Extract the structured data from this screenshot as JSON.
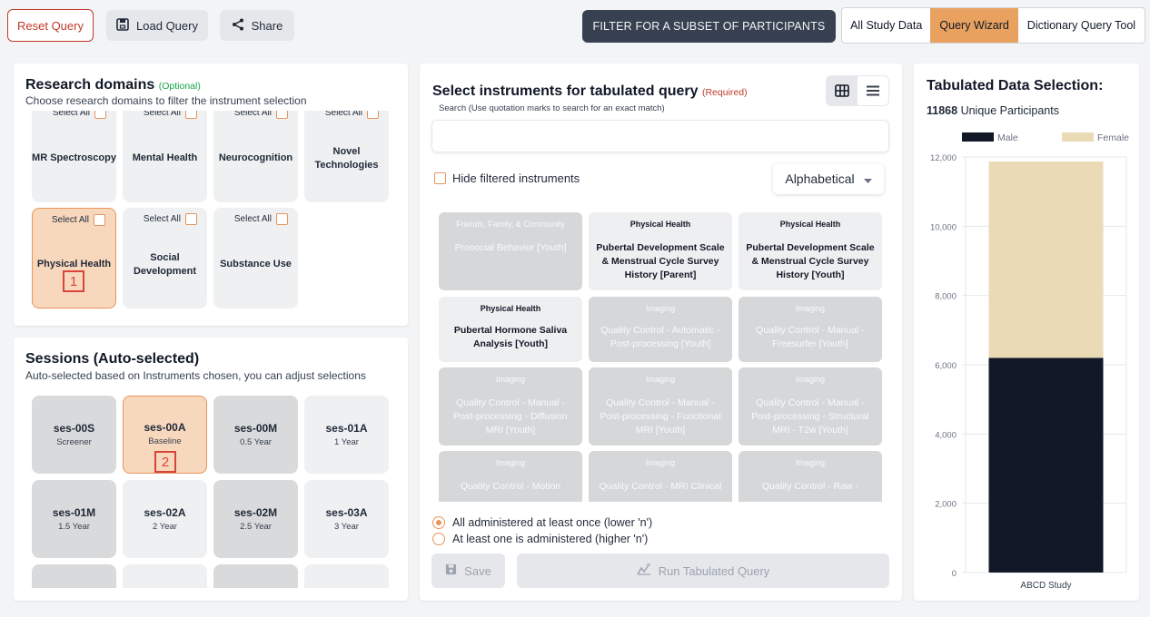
{
  "toolbar": {
    "reset_label": "Reset Query",
    "load_label": "Load Query",
    "share_label": "Share",
    "filter_label": "FILTER FOR A SUBSET OF PARTICIPANTS",
    "tabs": [
      "All Study Data",
      "Query Wizard",
      "Dictionary Query Tool"
    ],
    "active_tab": "Query Wizard"
  },
  "domains": {
    "title": "Research domains",
    "optional": "(Optional)",
    "subtitle": "Choose research domains to filter the instrument selection",
    "select_all_label": "Select All",
    "cards": [
      {
        "label": "MR Spectroscopy",
        "state": "default"
      },
      {
        "label": "Mental Health",
        "state": "default"
      },
      {
        "label": "Neurocognition",
        "state": "default"
      },
      {
        "label": "Novel Technologies",
        "state": "default"
      },
      {
        "label": "Physical Health",
        "state": "selected",
        "marker": "1"
      },
      {
        "label": "Social Development",
        "state": "default"
      },
      {
        "label": "Substance Use",
        "state": "default"
      }
    ]
  },
  "sessions": {
    "title": "Sessions (Auto-selected)",
    "subtitle": "Auto-selected based on Instruments chosen, you can adjust selections",
    "cards": [
      {
        "name": "ses-00S",
        "sub": "Screener",
        "state": "grey"
      },
      {
        "name": "ses-00A",
        "sub": "Baseline",
        "state": "selected",
        "marker": "2"
      },
      {
        "name": "ses-00M",
        "sub": "0.5 Year",
        "state": "grey"
      },
      {
        "name": "ses-01A",
        "sub": "1 Year",
        "state": "light"
      },
      {
        "name": "ses-01M",
        "sub": "1.5 Year",
        "state": "grey"
      },
      {
        "name": "ses-02A",
        "sub": "2 Year",
        "state": "light"
      },
      {
        "name": "ses-02M",
        "sub": "2.5 Year",
        "state": "grey"
      },
      {
        "name": "ses-03A",
        "sub": "3 Year",
        "state": "light"
      }
    ]
  },
  "instruments": {
    "title": "Select instruments for tabulated query",
    "required": "(Required)",
    "search_hint": "Search (Use quotation marks to search for an exact match)",
    "search_value": "",
    "hide_filtered_label": "Hide filtered instruments",
    "sort_value": "Alphabetical",
    "cards": [
      {
        "category": "Friends, Family, & Community",
        "name": "Prosocial Behavior [Youth]",
        "state": "grey"
      },
      {
        "category": "Physical Health",
        "name": "Pubertal Development Scale & Menstrual Cycle Survey History [Parent]",
        "state": "white"
      },
      {
        "category": "Physical Health",
        "name": "Pubertal Development Scale & Menstrual Cycle Survey History [Youth]",
        "state": "white"
      },
      {
        "category": "Physical Health",
        "name": "Pubertal Hormone Saliva Analysis [Youth]",
        "state": "white"
      },
      {
        "category": "Imaging",
        "name": "Quality Control - Automatic - Post-processing [Youth]",
        "state": "grey"
      },
      {
        "category": "Imaging",
        "name": "Quality Control - Manual - Freesurfer [Youth]",
        "state": "grey"
      },
      {
        "category": "Imaging",
        "name": "Quality Control - Manual - Post-processing - Diffusion MRI [Youth]",
        "state": "grey"
      },
      {
        "category": "Imaging",
        "name": "Quality Control - Manual - Post-processing - Functional MRI [Youth]",
        "state": "grey"
      },
      {
        "category": "Imaging",
        "name": "Quality Control - Manual - Post-processing - Structural MRI - T2w [Youth]",
        "state": "grey"
      },
      {
        "category": "Imaging",
        "name": "Quality Control - Motion",
        "state": "grey"
      },
      {
        "category": "Imaging",
        "name": "Quality Control - MRI Clinical",
        "state": "grey"
      },
      {
        "category": "Imaging",
        "name": "Quality Control - Raw -",
        "state": "grey"
      }
    ],
    "radio_options": [
      {
        "label": "All administered at least once (lower 'n')",
        "checked": true
      },
      {
        "label": "At least one is administered (higher 'n')",
        "checked": false
      }
    ],
    "save_label": "Save",
    "run_label": "Run Tabulated Query"
  },
  "tabulated": {
    "title": "Tabulated Data Selection:",
    "count": "11868",
    "count_label": "Unique Participants"
  },
  "chart_data": {
    "type": "bar",
    "stacked": true,
    "categories": [
      "ABCD Study"
    ],
    "series": [
      {
        "name": "Male",
        "values": [
          6200
        ],
        "color": "#111827"
      },
      {
        "name": "Female",
        "values": [
          5668
        ],
        "color": "#eadbb6"
      }
    ],
    "ylim": [
      0,
      12000
    ],
    "yticks": [
      0,
      2000,
      4000,
      6000,
      8000,
      10000,
      12000
    ],
    "ytick_labels": [
      "0",
      "2,000",
      "4,000",
      "6,000",
      "8,000",
      "10,000",
      "12,000"
    ],
    "legend": "top",
    "grid": true
  }
}
